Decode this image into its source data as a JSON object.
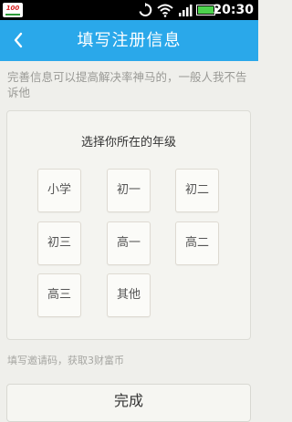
{
  "status_bar": {
    "time": "20:30",
    "app_logo_text": "100",
    "icons": [
      "app-logo",
      "sync-icon",
      "wifi-icon",
      "signal-icon",
      "battery-icon"
    ]
  },
  "header": {
    "back_icon": "chevron-left-icon",
    "title": "填写注册信息",
    "color": "#2aa8ea"
  },
  "intro": "完善信息可以提高解决率神马的，一般人我不告诉他",
  "grade_card": {
    "title": "选择你所在的年级",
    "options": [
      "小学",
      "初一",
      "初二",
      "初三",
      "高一",
      "高二",
      "高三",
      "其他"
    ]
  },
  "invite_text": "填写邀请码，获取3财富币",
  "finish_label": "完成"
}
